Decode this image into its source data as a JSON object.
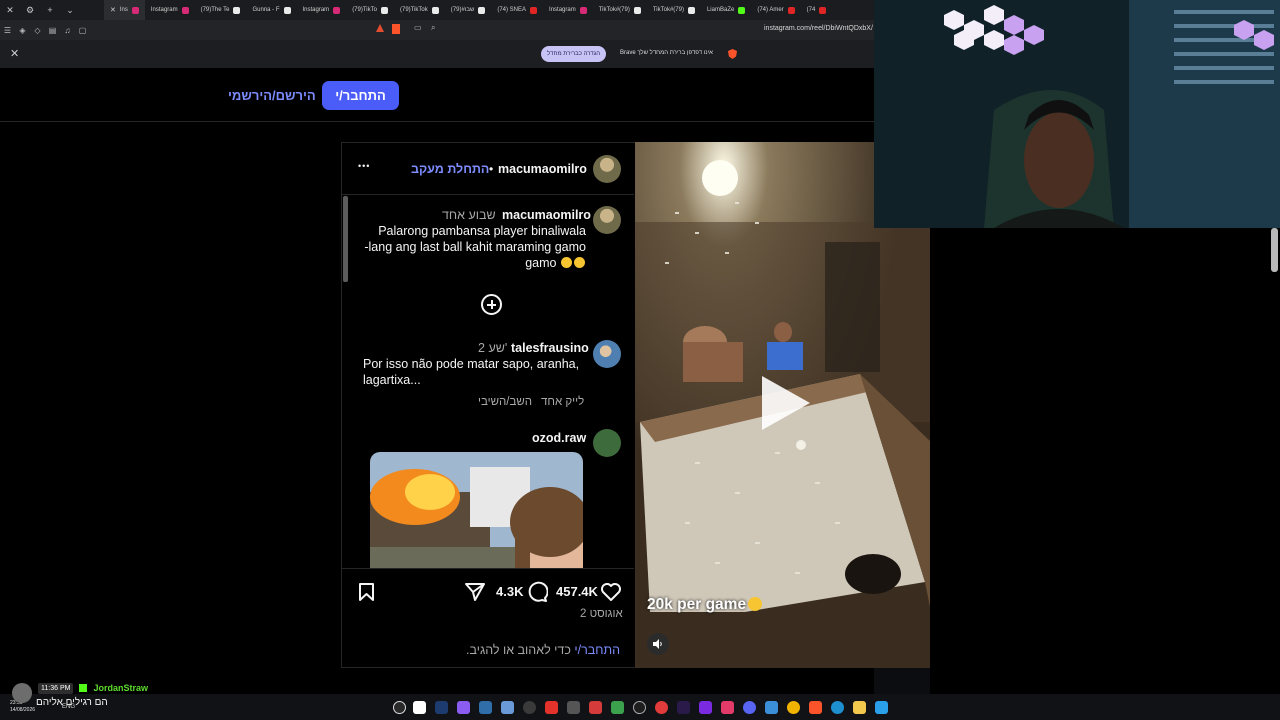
{
  "browser": {
    "tabs": [
      {
        "label": "",
        "favicon": "instagram",
        "active": false
      },
      {
        "label": "Ins",
        "favicon": "instagram",
        "active": true
      },
      {
        "label": "Instagram",
        "favicon": "instagram",
        "active": false
      },
      {
        "label": "(79)The Te",
        "favicon": "tiktok",
        "active": false
      },
      {
        "label": "Gunna - F",
        "favicon": "tiktok",
        "active": false
      },
      {
        "label": "Instagram",
        "favicon": "instagram",
        "active": false
      },
      {
        "label": "(79)TikTo",
        "favicon": "tiktok",
        "active": false
      },
      {
        "label": "(79)TikTok",
        "favicon": "tiktok",
        "active": false
      },
      {
        "label": "שבו#(79)",
        "favicon": "tiktok",
        "active": false
      },
      {
        "label": "(74) SNEA",
        "favicon": "youtube",
        "active": false
      },
      {
        "label": "Instagram",
        "favicon": "instagram",
        "active": false
      },
      {
        "label": "TikTok#(79)",
        "favicon": "tiktok",
        "active": false
      },
      {
        "label": "TikTok#(79)",
        "favicon": "tiktok",
        "active": false
      },
      {
        "label": "LiamBaZe",
        "favicon": "kick",
        "active": false
      },
      {
        "label": "(74) Amer",
        "favicon": "youtube",
        "active": false
      },
      {
        "label": "(74",
        "favicon": "youtube",
        "active": false
      }
    ],
    "url": "instagram.com/reel/DbiWntQDxbX/",
    "notification": {
      "text": "Brave אינו דפדפן ברירת המחדל שלך",
      "button": "הגדרה כברירת מחדל",
      "close": "✕"
    }
  },
  "instagram": {
    "login_button": "התחבר/י",
    "signup_link": "הירשם/הירשמי",
    "post": {
      "author": "macumaomilro",
      "follow_label": "התחלת מעקב",
      "separator": "•",
      "more": "•••",
      "caption": {
        "username": "macumaomilro",
        "time": "שבוע אחד",
        "text_line1": "Palarong pambansa player binaliwala",
        "text_line2": "lang ang last ball kahit maraming gamo-",
        "text_line3": "gamo"
      },
      "comments": [
        {
          "username": "talesfrausino",
          "time": "2 שע'",
          "text_line1": "Por isso não pode matar sapo, aranha,",
          "text_line2": "lagartixa...",
          "likes": "לייק אחד",
          "reply": "השב/השיבי"
        },
        {
          "username": "ozod.raw"
        }
      ],
      "likes_count": "457.4K",
      "comments_count": "4.3K",
      "date": "2 אוגוסט",
      "login_prompt_link": "התחבר/י",
      "login_prompt_text": "כדי לאהוב או להגיב."
    },
    "video": {
      "caption": "20k per game"
    }
  },
  "stream": {
    "chat": {
      "time": "11:36 PM",
      "user": "JordanStraw",
      "message": "הם רגילים אליהם"
    },
    "clock": {
      "time": "23:36",
      "date": "14/08/2026"
    },
    "tray_lang": "ENG"
  },
  "colors": {
    "accent": "#4a5df9",
    "link": "#7d8cff",
    "kick": "#53fc18"
  }
}
